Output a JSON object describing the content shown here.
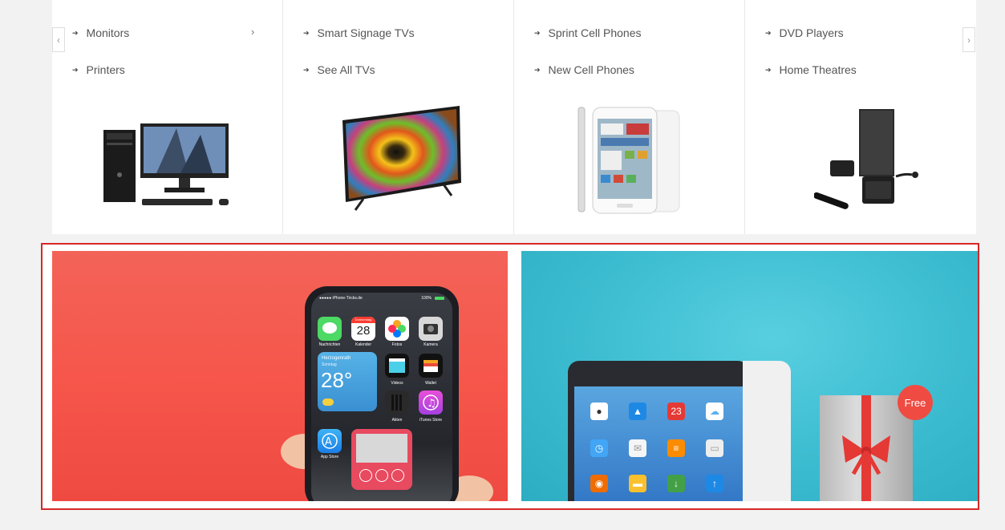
{
  "categories": [
    {
      "links": [
        "Monitors",
        "Printers"
      ],
      "has_chevron": true,
      "image": "desktop-computer"
    },
    {
      "links": [
        "Smart Signage TVs",
        "See All TVs"
      ],
      "has_chevron": false,
      "image": "flat-screen-tv"
    },
    {
      "links": [
        "Sprint Cell Phones",
        "New Cell Phones"
      ],
      "has_chevron": false,
      "image": "tablet-phone"
    },
    {
      "links": [
        "DVD Players",
        "Home Theatres"
      ],
      "has_chevron": false,
      "image": "home-theatre-speakers"
    }
  ],
  "carousel": {
    "prev_glyph": "‹",
    "next_glyph": "›",
    "chevron_glyph": "›",
    "bullet_glyph": "➔"
  },
  "banner_left": {
    "status_carrier": "●●●●● iPhone-Tricks.de",
    "status_battery": "100%",
    "calendar_day": "Donnerstag",
    "calendar_date": "28",
    "weather_city": "Herzogenrath",
    "weather_day": "Sonntag",
    "weather_temp": "28°",
    "labels": [
      "Nachrichten",
      "Kalender",
      "Fotos",
      "Kamera",
      "Videos",
      "Wallet",
      "Akten",
      "iTunes Store",
      "App Store"
    ]
  },
  "banner_right": {
    "calendar_date": "23",
    "free_badge": "Free"
  },
  "colors": {
    "banner_left_bg": "#f6554a",
    "banner_right_bg": "#40bfd3",
    "highlight_border": "#d62828",
    "free_badge": "#ef4b42"
  }
}
